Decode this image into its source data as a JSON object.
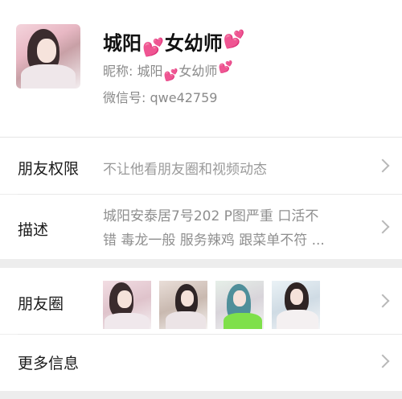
{
  "profile": {
    "name_part1": "城阳",
    "name_part2": "女幼师",
    "heart": "💕",
    "nickname_label": "昵称: ",
    "nickname_part1": "城阳",
    "nickname_part2": "女幼师",
    "wechat_label": "微信号: ",
    "wechat_id": "qwe42759"
  },
  "rows": {
    "permissions": {
      "label": "朋友权限",
      "value": "不让他看朋友圈和视频动态"
    },
    "description": {
      "label": "描述",
      "line1": "城阳安泰居7号202  P图严重 口活不",
      "line2": "错 毒龙一般 服务辣鸡 跟菜单不符 ..."
    },
    "moments": {
      "label": "朋友圈"
    },
    "more": {
      "label": "更多信息"
    }
  },
  "colors": {
    "heart": "#ec4f9a",
    "bg": "#ededed"
  }
}
